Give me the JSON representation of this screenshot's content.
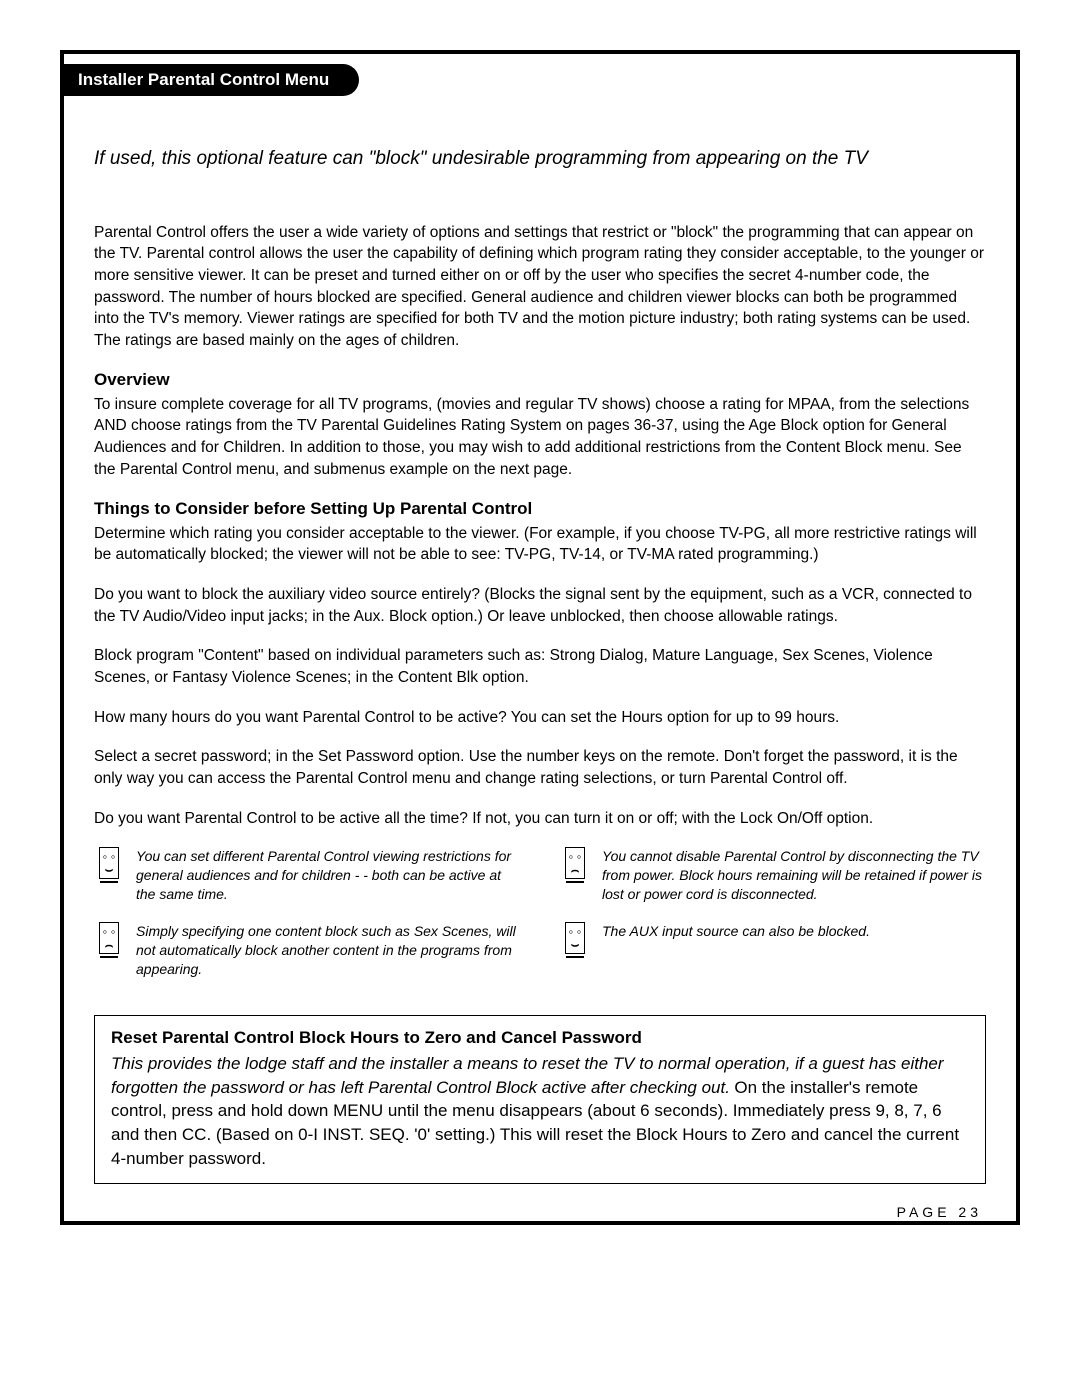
{
  "tab_title": "Installer Parental Control Menu",
  "intro": "If used, this optional feature can \"block\" undesirable programming from appearing on the TV",
  "p1": "Parental Control offers the user a wide variety of options and settings that restrict or \"block\" the programming that can appear on the TV. Parental control allows the user the capability of defining which program rating they consider acceptable, to the younger or more sensitive viewer. It can be preset and turned either on or off by the user who specifies the secret 4-number code, the password. The number of hours blocked are specified. General audience and children viewer blocks can both be programmed into the TV's memory.  Viewer ratings are specified for both TV and the motion picture industry; both rating systems can be used. The ratings are based mainly on the ages of children.",
  "h_overview": "Overview",
  "p_overview": "To insure complete coverage for all TV programs, (movies and regular TV shows) choose a rating for MPAA, from the selections AND choose ratings from the TV Parental Guidelines Rating System on pages 36-37, using the Age Block option for General Audiences and for Children. In addition to those, you may wish to add additional restrictions from the Content Block menu. See the Parental Control menu, and submenus example on the next page.",
  "h_things": "Things to Consider before Setting Up Parental Control",
  "things": {
    "p1": "Determine which rating you consider acceptable to the viewer. (For example, if you choose TV-PG, all more restrictive ratings will be automatically blocked; the viewer will not be able to see: TV-PG, TV-14, or  TV-MA rated programming.)",
    "p2": "Do you want to block the auxiliary video source entirely? (Blocks the signal sent by the equipment, such as a VCR, connected to the TV Audio/Video input jacks; in the Aux. Block option.) Or leave unblocked, then choose allowable ratings.",
    "p3": "Block program \"Content\" based on individual parameters such as: Strong Dialog, Mature Language, Sex Scenes, Violence Scenes, or Fantasy Violence Scenes; in the Content Blk option.",
    "p4": "How many hours do you want Parental Control to be active? You can set the Hours option for up to 99 hours.",
    "p5": "Select a secret password; in the Set Password option. Use the number keys on the remote. Don't forget the password, it is the only way you can access the Parental Control menu and change rating selections, or turn Parental Control off.",
    "p6": "Do you want Parental Control to be active all the time? If not, you can turn it on or off; with the Lock On/Off option."
  },
  "tips": {
    "l1": "You can set different Parental Control viewing restrictions for general audiences and for children - - both can be active at the same time.",
    "l2": "Simply specifying one content block such as Sex Scenes, will not automatically block another content in the programs from appearing.",
    "r1": "You cannot disable Parental Control by disconnecting the TV from power. Block hours remaining will be retained if power is lost or power cord is disconnected.",
    "r2": "The AUX input source can also be blocked."
  },
  "reset": {
    "h": "Reset Parental Control Block Hours to Zero and Cancel Password",
    "italic": "This provides the lodge staff and the installer a means to reset the TV to normal operation, if a guest has either forgotten the password or has left Parental Control Block active after checking out.",
    "body": "On the installer's remote control, press and hold down MENU until the menu disappears (about 6 seconds). Immediately press 9, 8, 7, 6 and then CC. (Based on 0-I INST. SEQ. '0' setting.) This will reset the Block Hours to Zero and cancel the current 4-number password."
  },
  "page_label": "PAGE 23"
}
